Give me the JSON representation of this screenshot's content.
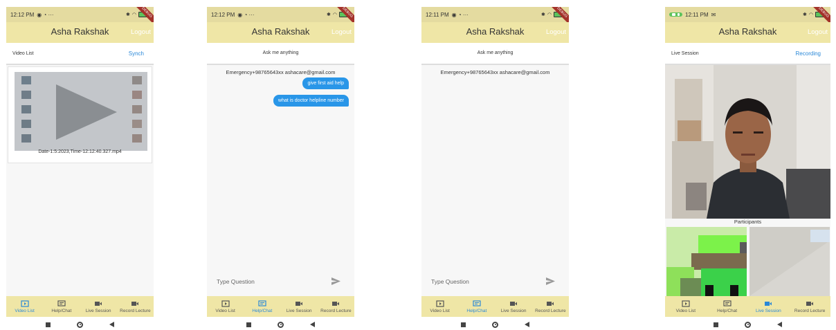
{
  "app": {
    "title": "Asha Rakshak",
    "logout_label": "Logout",
    "debug_ribbon": "DEBUG"
  },
  "nav": {
    "items": [
      "Video List",
      "Help/Chat",
      "Live Session",
      "Record Lecture"
    ]
  },
  "screens": [
    {
      "status_time": "12:12 PM",
      "subbar_left": "Video List",
      "subbar_right": "Synch",
      "active_tab": "Video List",
      "video_caption": "Date-1:5:2023,Time-12:12:40.327.mp4"
    },
    {
      "status_time": "12:12 PM",
      "subbar_center": "Ask me anything",
      "active_tab": "Help/Chat",
      "emergency": "Emergency+98765643xx ashacare@gmail.com",
      "messages": [
        "give first aid help",
        "what is doctor helpline number"
      ],
      "input_placeholder": "Type Question"
    },
    {
      "status_time": "12:11 PM",
      "subbar_center": "Ask me anything",
      "active_tab": "Help/Chat",
      "emergency": "Emergency+98765643xx ashacare@gmail.com",
      "input_placeholder": "Type Question"
    },
    {
      "status_time": "12:11 PM",
      "subbar_left": "Live Session",
      "subbar_right": "Recording",
      "active_tab": "Live Session",
      "participants_label": "Participants"
    }
  ],
  "colors": {
    "appbar": "#efe6a6",
    "statusbar": "#e4dba0",
    "accent": "#2a88d8",
    "bubble": "#2996e8"
  }
}
